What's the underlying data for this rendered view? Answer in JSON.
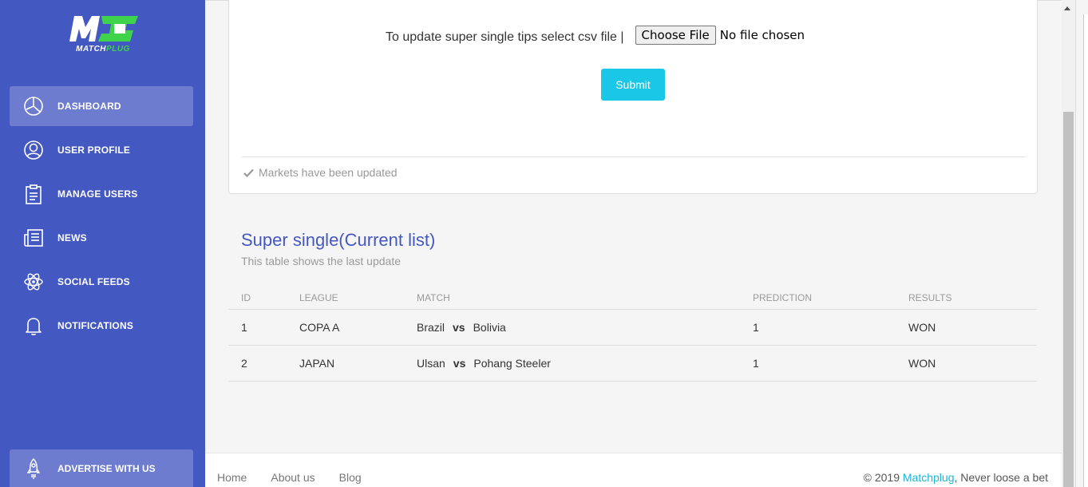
{
  "brand": {
    "logo_mark": "MC",
    "logo_text_a": "MATCH",
    "logo_text_b": "PLUG",
    "primary_color": "#4458c1",
    "accent_color": "#3ed34a"
  },
  "sidebar": {
    "items": [
      {
        "label": "DASHBOARD",
        "icon": "pie-chart-icon",
        "active": true
      },
      {
        "label": "USER PROFILE",
        "icon": "user-icon",
        "active": false
      },
      {
        "label": "MANAGE USERS",
        "icon": "clipboard-icon",
        "active": false
      },
      {
        "label": "NEWS",
        "icon": "newspaper-icon",
        "active": false
      },
      {
        "label": "SOCIAL FEEDS",
        "icon": "atom-icon",
        "active": false
      },
      {
        "label": "NOTIFICATIONS",
        "icon": "bell-icon",
        "active": false
      }
    ],
    "bottom_item": {
      "label": "ADVERTISE WITH US",
      "icon": "rocket-icon"
    }
  },
  "upload": {
    "label": "To update super single tips select csv file |",
    "file_button": "Choose File",
    "file_status": "No file chosen",
    "submit_label": "Submit",
    "submit_color": "#1bc7e6",
    "footer_status": "Markets have been updated"
  },
  "table_section": {
    "title": "Super single(Current list)",
    "subtitle": "This table shows the last update",
    "columns": [
      "ID",
      "LEAGUE",
      "MATCH",
      "PREDICTION",
      "RESULTS"
    ],
    "rows": [
      {
        "id": "1",
        "league": "COPA A",
        "home": "Brazil",
        "vs": "vs",
        "away": "Bolivia",
        "prediction": "1",
        "result": "WON"
      },
      {
        "id": "2",
        "league": "JAPAN",
        "home": "Ulsan",
        "vs": "vs",
        "away": "Pohang Steeler",
        "prediction": "1",
        "result": "WON"
      }
    ]
  },
  "footer": {
    "links": [
      "Home",
      "About us",
      "Blog"
    ],
    "copyright_prefix": "© 2019 ",
    "copyright_brand": "Matchplug",
    "copyright_suffix": ", Never loose a bet"
  }
}
